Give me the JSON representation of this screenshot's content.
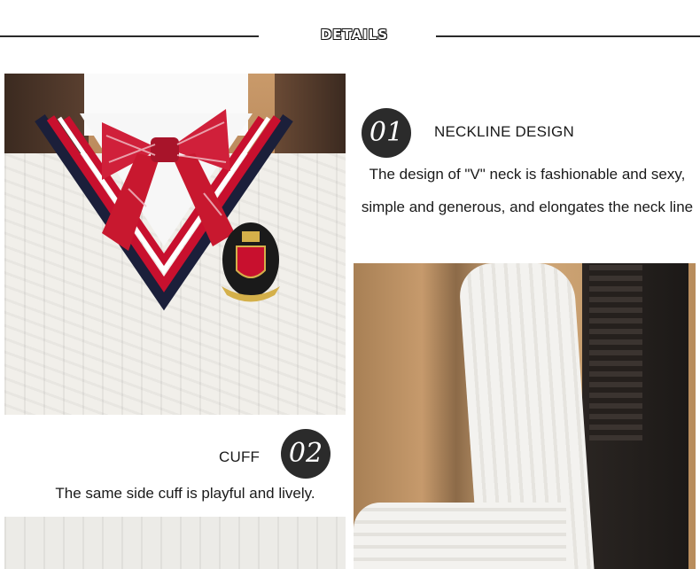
{
  "header": {
    "title": "DETAILS"
  },
  "sections": [
    {
      "number": "01",
      "heading": "NECKLINE DESIGN",
      "description": "The design of \"V\" neck is fashionable and sexy, simple and generous, and elongates the neck line"
    },
    {
      "number": "02",
      "heading": "CUFF",
      "description": "The same side cuff is playful and lively."
    }
  ],
  "colors": {
    "background": "#ffffff",
    "badge": "#2b2b2b",
    "text": "#1a1a1a",
    "stripe_red": "#c8102e",
    "stripe_navy": "#1b1f3a"
  }
}
